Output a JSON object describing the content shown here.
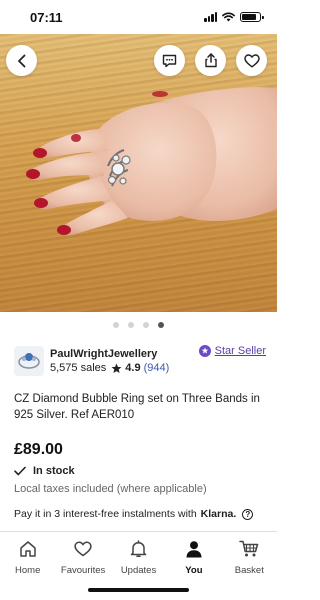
{
  "status_bar": {
    "time": "07:11"
  },
  "carousel": {
    "total_images": 4,
    "active_index": 3
  },
  "seller": {
    "name": "PaulWrightJewellery",
    "sales": "5,575 sales",
    "rating": "4.9",
    "reviews": "(944)",
    "badge": "Star Seller"
  },
  "listing": {
    "title": "CZ Diamond Bubble Ring set on Three Bands in 925 Silver. Ref AER010",
    "price": "£89.00",
    "stock": "In stock",
    "tax_note": "Local taxes included (where applicable)"
  },
  "klarna": {
    "text": "Pay it in 3 interest-free instalments with",
    "brand": "Klarna."
  },
  "nav": {
    "items": [
      {
        "label": "Home",
        "icon": "home-icon"
      },
      {
        "label": "Favourites",
        "icon": "heart-icon"
      },
      {
        "label": "Updates",
        "icon": "bell-icon"
      },
      {
        "label": "You",
        "icon": "person-icon"
      },
      {
        "label": "Basket",
        "icon": "cart-icon"
      }
    ],
    "active": "You"
  },
  "colors": {
    "accent_purple": "#5a3ea0",
    "link_blue": "#3b5bab",
    "text": "#222222",
    "muted": "#666666"
  }
}
